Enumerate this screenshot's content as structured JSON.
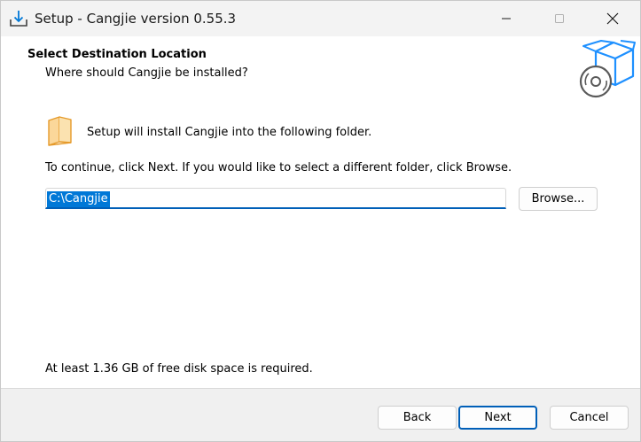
{
  "window": {
    "title": "Setup - Cangjie version 0.55.3"
  },
  "header": {
    "title": "Select Destination Location",
    "subtitle": "Where should Cangjie be installed?"
  },
  "body": {
    "install_text": "Setup will install Cangjie into the following folder.",
    "continue_text": "To continue, click Next. If you would like to select a different folder, click Browse.",
    "path_value": "C:\\Cangjie",
    "browse_label": "Browse...",
    "space_text": "At least 1.36 GB of free disk space is required."
  },
  "footer": {
    "back_label": "Back",
    "next_label": "Next",
    "cancel_label": "Cancel"
  },
  "icons": {
    "app": "download-tray-icon",
    "minimize": "minimize-icon",
    "maximize": "maximize-icon",
    "close": "close-icon",
    "header_image": "box-with-disc-icon",
    "folder": "folder-icon"
  },
  "colors": {
    "accent": "#005fb8",
    "selection": "#0078d7",
    "folder": "#f5a623",
    "box": "#1e90ff"
  }
}
